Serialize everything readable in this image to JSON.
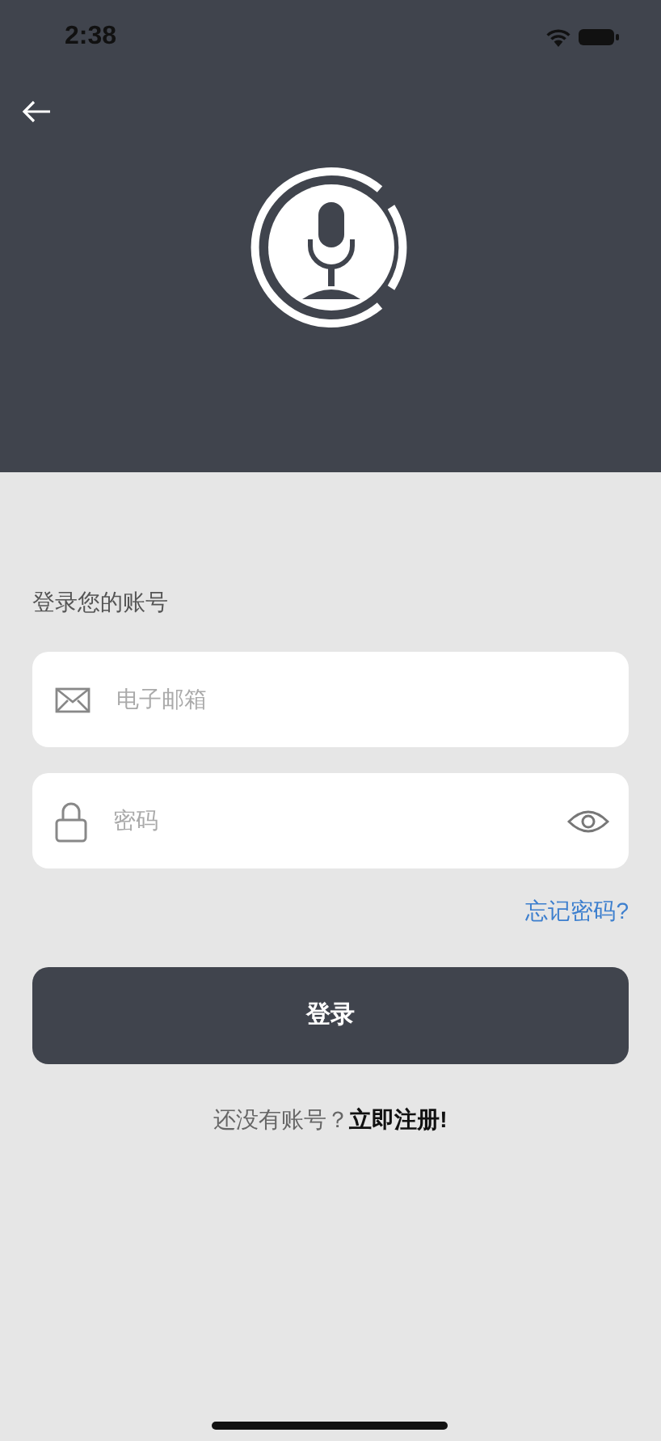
{
  "status_bar": {
    "time": "2:38"
  },
  "heading": "登录您的账号",
  "fields": [
    {
      "kind": "email",
      "placeholder": "电子邮箱"
    },
    {
      "kind": "password",
      "placeholder": "密码"
    }
  ],
  "forgot_link": "忘记密码?",
  "login_button": "登录",
  "register": {
    "prompt": "还没有账号？",
    "link": "立即注册!"
  }
}
